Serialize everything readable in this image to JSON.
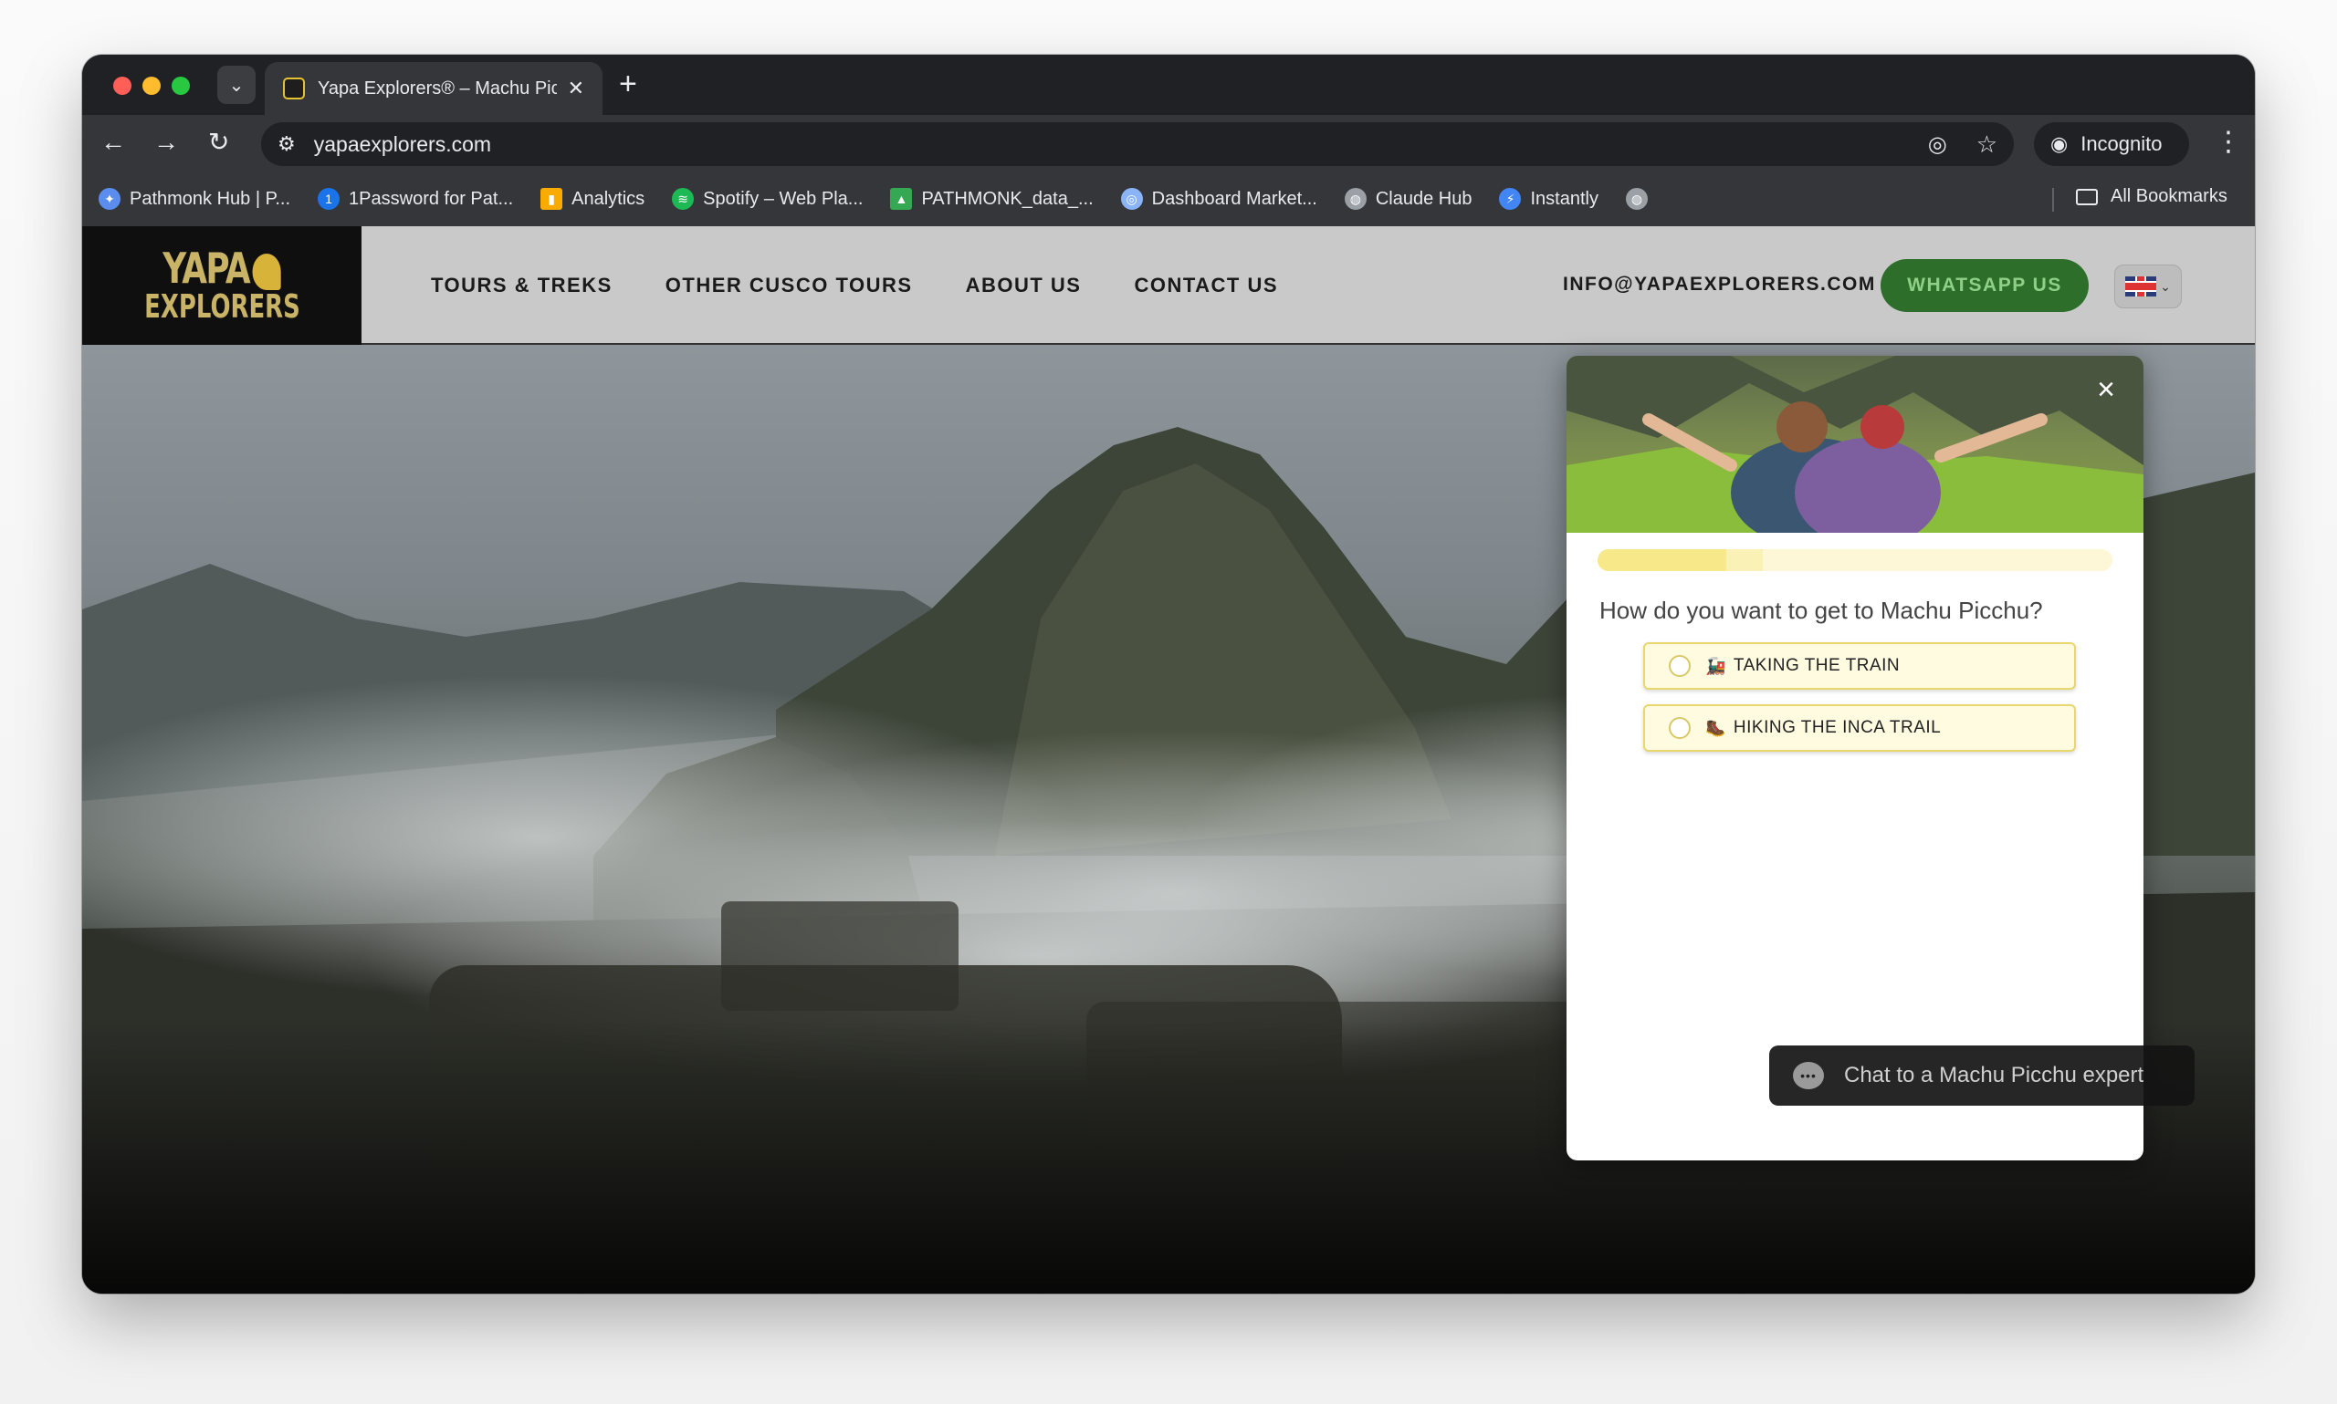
{
  "browser": {
    "tab": {
      "title": "Yapa Explorers® – Machu Picchu",
      "close_icon": "✕"
    },
    "new_tab_icon": "+",
    "address": "yapaexplorers.com",
    "incognito_label": "Incognito",
    "bookmarks": [
      {
        "label": "Pathmonk Hub | P...",
        "icon": "pathmonk-icon",
        "color": "#5b8def"
      },
      {
        "label": "1Password for Pat...",
        "icon": "1password-icon",
        "color": "#1a73e8"
      },
      {
        "label": "Analytics",
        "icon": "analytics-icon",
        "color": "#f9ab00"
      },
      {
        "label": "Spotify – Web Pla...",
        "icon": "spotify-icon",
        "color": "#1db954"
      },
      {
        "label": "PATHMONK_data_...",
        "icon": "drive-icon",
        "color": "#34a853"
      },
      {
        "label": "Dashboard Market...",
        "icon": "dashboard-icon",
        "color": "#8ab4f8"
      },
      {
        "label": "Claude Hub",
        "icon": "globe-icon",
        "color": "#9aa0a6"
      },
      {
        "label": "Instantly",
        "icon": "instantly-icon",
        "color": "#4285f4"
      }
    ],
    "all_bookmarks": "All Bookmarks"
  },
  "site": {
    "logo": {
      "line1": "YAPA",
      "line2": "EXPLORERS"
    },
    "menu": [
      "TOURS & TREKS",
      "OTHER CUSCO TOURS",
      "ABOUT US",
      "CONTACT US"
    ],
    "email": "INFO@YAPAEXPLORERS.COM",
    "whatsapp": "WHATSAPP US"
  },
  "quiz": {
    "progress": 0.25,
    "question": "How do you want to get to Machu Picchu?",
    "options": [
      {
        "emoji": "🚂",
        "label": "TAKING THE TRAIN"
      },
      {
        "emoji": "🥾",
        "label": "HIKING THE INCA TRAIL"
      }
    ]
  },
  "chat": {
    "label": "Chat to a Machu Picchu expert",
    "icon": "chat-bubble-icon"
  },
  "colors": {
    "accent": "#e8d76a",
    "whatsapp": "#2c6e2a",
    "logo_gold": "#c8b366"
  }
}
